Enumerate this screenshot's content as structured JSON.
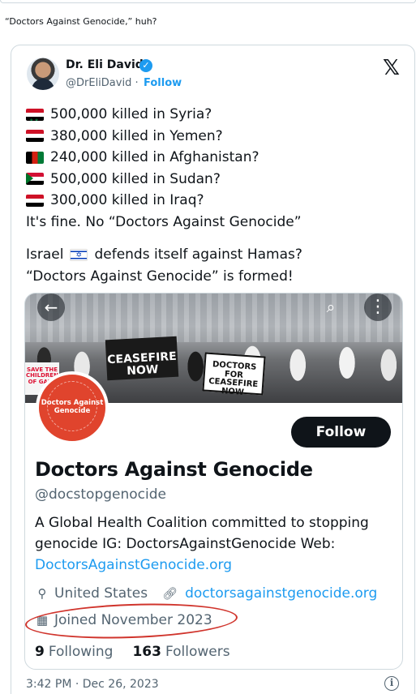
{
  "post": {
    "caption": "“Doctors Against Genocide,” huh?"
  },
  "tweet": {
    "author_name": "Dr. Eli David",
    "author_handle": "@DrEliDavid",
    "follow_label": "Follow",
    "separator": "·",
    "lines": [
      {
        "flag": "syria-flag-icon",
        "text": "500,000 killed in Syria?"
      },
      {
        "flag": "yemen-flag-icon",
        "text": "380,000 killed in Yemen?"
      },
      {
        "flag": "afghanistan-flag-icon",
        "text": "240,000 killed in Afghanistan?"
      },
      {
        "flag": "sudan-flag-icon",
        "text": "500,000 killed in Sudan?"
      },
      {
        "flag": "iraq-flag-icon",
        "text": "300,000 killed in Iraq?"
      }
    ],
    "line_fine": "It's fine. No “Doctors Against Genocide”",
    "line_israel_pre": "Israel",
    "line_israel_post": "defends itself against Hamas?",
    "line_formed": "“Doctors Against Genocide” is formed!",
    "timestamp": "3:42 PM · Dec 26, 2023"
  },
  "profile_card": {
    "banner_signs": {
      "ceasefire": "CEASEFIRE NOW",
      "doctors_for": "DOCTORS FOR CEASEFIRE NOW",
      "children": "SAVE THE CHILDREN OF GAZA"
    },
    "avatar_text": "Doctors Against Genocide",
    "follow_button": "Follow",
    "name": "Doctors Against Genocide",
    "handle": "@docstopgenocide",
    "bio": "A Global Health Coalition committed to stopping genocide  IG: DoctorsAgainstGenocide Web:",
    "bio_link": "DoctorsAgainstGenocide.org",
    "location": "United States",
    "website": "doctorsagainstgenocide.org",
    "joined": "Joined November 2023",
    "following_count": "9",
    "following_label": "Following",
    "followers_count": "163",
    "followers_label": "Followers"
  },
  "icons": {
    "verified": "verified-badge-icon",
    "x_logo": "x-logo-icon",
    "back": "back-arrow-icon",
    "search": "search-icon",
    "more": "more-icon",
    "location": "location-pin-icon",
    "link": "link-icon",
    "calendar": "calendar-icon",
    "info": "info-icon"
  },
  "colors": {
    "accent": "#1d9bf0",
    "muted": "#536471",
    "text": "#0f1419",
    "annotation_circle": "#d0342c",
    "avatar_bg": "#e0442d"
  }
}
